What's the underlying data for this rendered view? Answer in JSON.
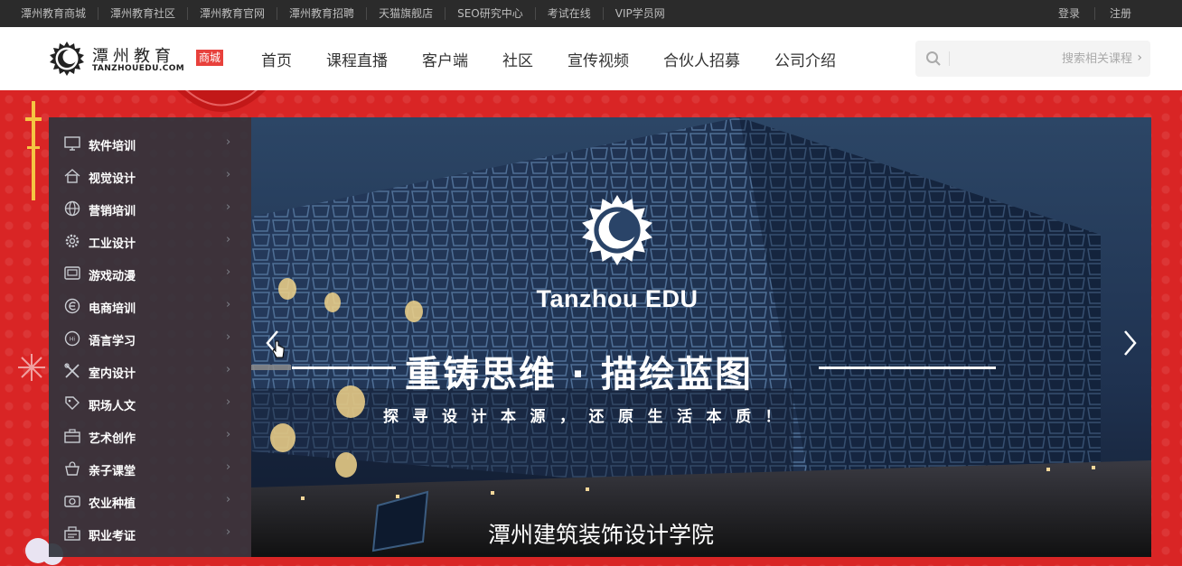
{
  "topbar": {
    "links": [
      "潭州教育商城",
      "潭州教育社区",
      "潭州教育官网",
      "潭州教育招聘",
      "天猫旗舰店",
      "SEO研究中心",
      "考试在线",
      "VIP学员网"
    ],
    "login": "登录",
    "register": "注册"
  },
  "header": {
    "brand_cn": "潭州教育",
    "brand_en": "TANZHOUEDU.COM",
    "badge": "商城",
    "nav": [
      "首页",
      "课程直播",
      "客户端",
      "社区",
      "宣传视频",
      "合伙人招募",
      "公司介绍"
    ],
    "search_placeholder": "搜索相关课程",
    "accent_color": "#e8413c"
  },
  "categories": [
    {
      "label": "软件培训",
      "icon": "monitor-icon"
    },
    {
      "label": "视觉设计",
      "icon": "house-icon"
    },
    {
      "label": "营销培训",
      "icon": "globe-icon"
    },
    {
      "label": "工业设计",
      "icon": "gear-icon"
    },
    {
      "label": "游戏动漫",
      "icon": "screen-icon"
    },
    {
      "label": "电商培训",
      "icon": "ecommerce-icon"
    },
    {
      "label": "语言学习",
      "icon": "speech-icon"
    },
    {
      "label": "室内设计",
      "icon": "tools-icon"
    },
    {
      "label": "职场人文",
      "icon": "tag-icon"
    },
    {
      "label": "艺术创作",
      "icon": "briefcase-icon"
    },
    {
      "label": "亲子课堂",
      "icon": "basket-icon"
    },
    {
      "label": "农业种植",
      "icon": "camera-icon"
    },
    {
      "label": "职业考证",
      "icon": "certificate-icon"
    }
  ],
  "banner": {
    "brand": "Tanzhou EDU",
    "title": "重铸思维 · 描绘蓝图",
    "subtitle": "探寻设计本源，还原生活本质！",
    "caption": "潭州建筑装饰设计学院",
    "background_color": "#d92525"
  }
}
